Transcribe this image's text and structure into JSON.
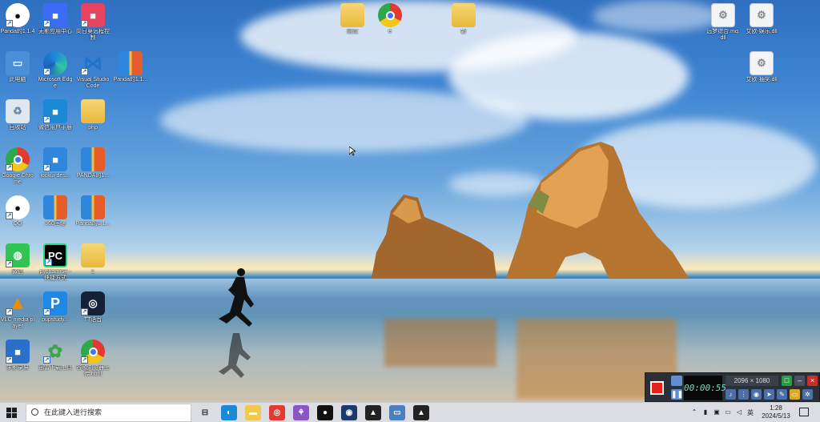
{
  "desktop_icons": [
    {
      "label": "Panda的1.1.4",
      "kind": "qq",
      "color": "#1a1a1a"
    },
    {
      "label": "无影应用中心",
      "kind": "app",
      "color": "#3c6cf5"
    },
    {
      "label": "向日葵远程控制",
      "kind": "app",
      "color": "#e64460"
    },
    {
      "label": "此电脑",
      "kind": "pc",
      "color": "#4a8fd8"
    },
    {
      "label": "Microsoft Edge",
      "kind": "edge",
      "color": "#1b8ad6"
    },
    {
      "label": "Visual Studio Code",
      "kind": "vscode",
      "color": "#1f75c9"
    },
    {
      "label": "Panda的1.1...",
      "kind": "zip",
      "color": "#f0c040"
    },
    {
      "label": "回收站",
      "kind": "bin",
      "color": "#c9d6e4"
    },
    {
      "label": "微信用户手册",
      "kind": "app",
      "color": "#1b8ad6"
    },
    {
      "label": "php",
      "kind": "folder",
      "color": "#f3c84e"
    },
    {
      "label": "Google Chrome",
      "kind": "chrome",
      "color": "#e23a2e"
    },
    {
      "label": "lockui-des...",
      "kind": "app",
      "color": "#2f86dd"
    },
    {
      "label": "PANDA的1...",
      "kind": "zip",
      "color": "#f0c040"
    },
    {
      "label": "QQ",
      "kind": "qq",
      "color": "#111"
    },
    {
      "label": "360压缩",
      "kind": "zip",
      "color": "#f0c040"
    },
    {
      "label": "Panda的1.1...",
      "kind": "zip",
      "color": "#f0c040"
    },
    {
      "label": "微信",
      "kind": "wechat",
      "color": "#31c454"
    },
    {
      "label": "pycharm64 - 快捷方式",
      "kind": "pycharm",
      "color": "#21d789"
    },
    {
      "label": "1",
      "kind": "folder",
      "color": "#f3c84e"
    },
    {
      "label": "VLC media player",
      "kind": "vlc",
      "color": "#f28a00"
    },
    {
      "label": "pupstudy...",
      "kind": "p",
      "color": "#1e88e5"
    },
    {
      "label": "TT语音",
      "kind": "tt",
      "color": "#132038"
    },
    {
      "label": "求影录屏",
      "kind": "app",
      "color": "#2a6fc9"
    },
    {
      "label": "迅雷下载工具",
      "kind": "xl",
      "color": "#3ea54d"
    },
    {
      "label": "谷歌浏览器上传.html",
      "kind": "chrome",
      "color": "#e23a2e"
    },
    {
      "label": "测试",
      "kind": "folder",
      "color": "#f3c84e"
    },
    {
      "label": "e",
      "kind": "chromefile",
      "color": "#e23a2e"
    },
    {
      "label": "新",
      "kind": "file",
      "color": "#f3c84e"
    },
    {
      "label": "远梦综合.mq.dll",
      "kind": "dll",
      "color": "#e9edf2"
    },
    {
      "label": "艾欧-娱乐.dll",
      "kind": "dll",
      "color": "#e9edf2"
    },
    {
      "label": "艾欧-抽奖.dll",
      "kind": "dll",
      "color": "#e9edf2"
    }
  ],
  "recorder": {
    "timer": "00:00:55",
    "resolution": "2096 × 1080",
    "colors": {
      "record": "#e2231a",
      "timer": "#6fe2c2"
    }
  },
  "taskbar": {
    "search_placeholder": "在此键入进行搜索",
    "apps": [
      {
        "name": "task-view-icon",
        "color": "#444"
      },
      {
        "name": "edge-icon",
        "color": "#1b8ad6"
      },
      {
        "name": "file-explorer-icon",
        "color": "#f3c84e"
      },
      {
        "name": "chrome-icon",
        "color": "#e23a2e"
      },
      {
        "name": "app-icon",
        "color": "#8a56c4"
      },
      {
        "name": "qq-icon",
        "color": "#111"
      },
      {
        "name": "screen-recorder-icon",
        "color": "#1b3a6b"
      },
      {
        "name": "cat-app-icon",
        "color": "#222"
      },
      {
        "name": "monitor-app-icon",
        "color": "#4a7fbf"
      },
      {
        "name": "cat-app-2-icon",
        "color": "#222"
      }
    ],
    "ime": "英",
    "time": "1:28",
    "date": "2024/5/13"
  }
}
